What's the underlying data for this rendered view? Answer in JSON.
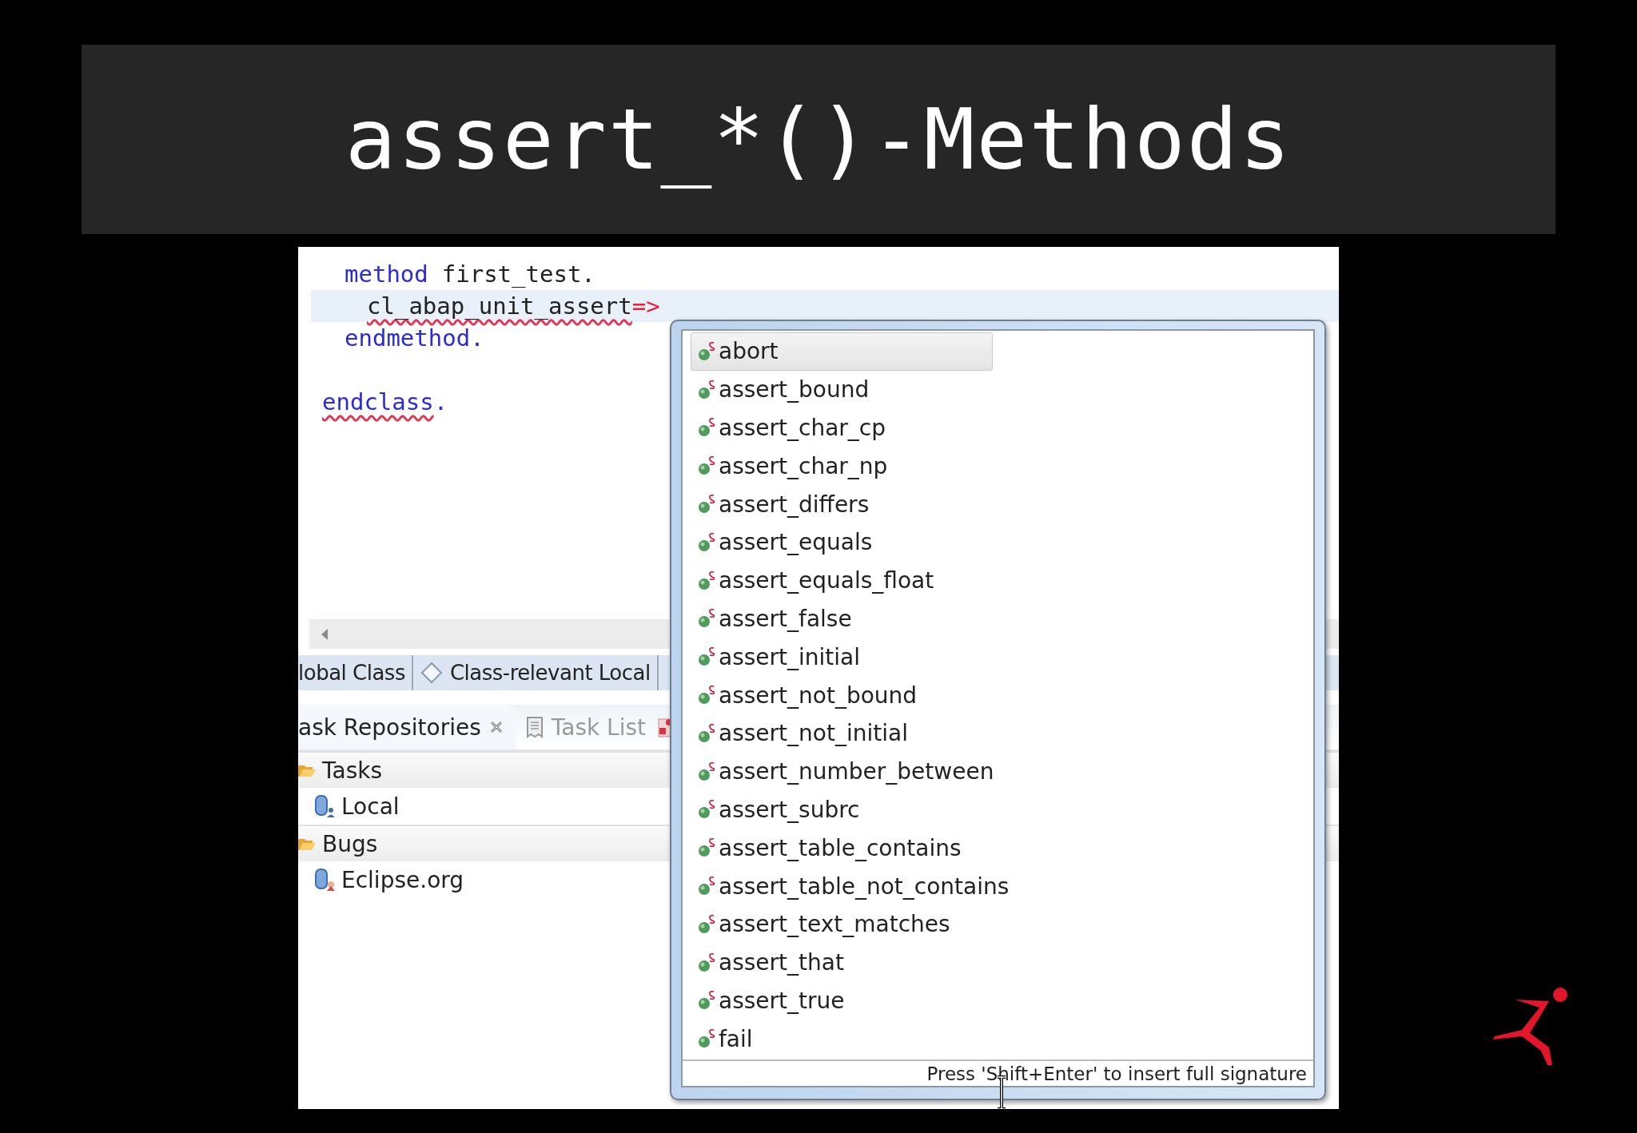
{
  "title": "assert_*()-Methods",
  "editor": {
    "lines": [
      {
        "kind": "member",
        "tokens": [
          {
            "text": "method",
            "kind": "keyword",
            "error": false
          },
          {
            "text": "first_test.",
            "kind": "plain",
            "error": false
          }
        ]
      },
      {
        "kind": "statement",
        "current": true,
        "tokens": [
          {
            "text": "cl_abap_unit_assert",
            "kind": "plain",
            "error": true
          },
          {
            "text": "=>",
            "kind": "operator",
            "error": false
          }
        ]
      },
      {
        "kind": "member",
        "tokens": [
          {
            "text": "endmethod.",
            "kind": "keyword",
            "error": false
          }
        ]
      },
      {
        "kind": "blank"
      },
      {
        "kind": "class",
        "tokens": [
          {
            "text": "endclass",
            "kind": "keyword",
            "error": true
          },
          {
            "text": ".",
            "kind": "keyword",
            "error": false
          }
        ]
      }
    ]
  },
  "editor_tabs": [
    {
      "label": "lobal Class"
    },
    {
      "label": "Class-relevant Local"
    }
  ],
  "view_tabs": [
    {
      "label": "ask Repositories",
      "selected": true
    },
    {
      "label": "Task List",
      "selected": false
    },
    {
      "selected": false
    }
  ],
  "tree": [
    {
      "label": "Tasks",
      "children": [
        {
          "label": "Local"
        }
      ]
    },
    {
      "label": "Bugs",
      "children": [
        {
          "label": "Eclipse.org"
        }
      ]
    }
  ],
  "completion": {
    "items": [
      {
        "label": "abort",
        "selected": true
      },
      {
        "label": "assert_bound",
        "selected": false
      },
      {
        "label": "assert_char_cp",
        "selected": false
      },
      {
        "label": "assert_char_np",
        "selected": false
      },
      {
        "label": "assert_differs",
        "selected": false
      },
      {
        "label": "assert_equals",
        "selected": false
      },
      {
        "label": "assert_equals_float",
        "selected": false
      },
      {
        "label": "assert_false",
        "selected": false
      },
      {
        "label": "assert_initial",
        "selected": false
      },
      {
        "label": "assert_not_bound",
        "selected": false
      },
      {
        "label": "assert_not_initial",
        "selected": false
      },
      {
        "label": "assert_number_between",
        "selected": false
      },
      {
        "label": "assert_subrc",
        "selected": false
      },
      {
        "label": "assert_table_contains",
        "selected": false
      },
      {
        "label": "assert_table_not_contains",
        "selected": false
      },
      {
        "label": "assert_text_matches",
        "selected": false
      },
      {
        "label": "assert_that",
        "selected": false
      },
      {
        "label": "assert_true",
        "selected": false
      },
      {
        "label": "fail",
        "selected": false
      }
    ],
    "hint": "Press 'Shift+Enter' to insert full signature"
  }
}
